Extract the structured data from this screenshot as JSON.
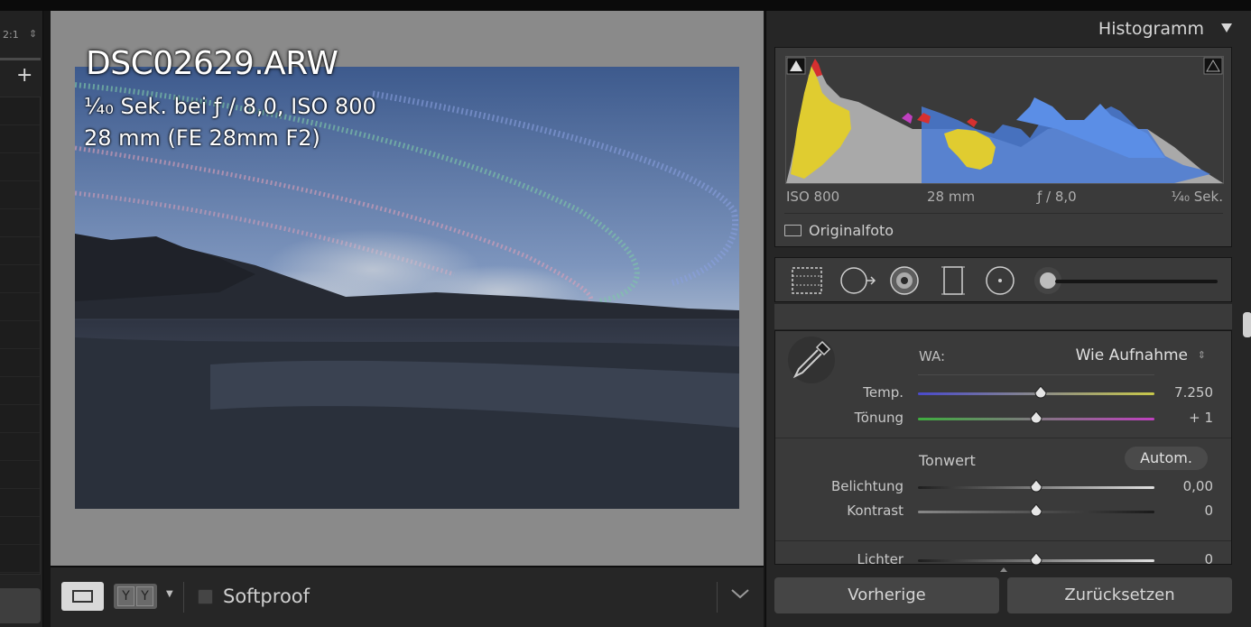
{
  "left_panel": {
    "zoom_ratio": "2:1",
    "zoom_stepper_icon": "updown-stepper-icon",
    "add_icon": "+"
  },
  "loupe": {
    "filename": "DSC02629.ARW",
    "exposure_info": "¹⁄₄₀ Sek. bei ƒ / 8,0, ISO 800",
    "lens_info": "28 mm (FE 28mm F2)"
  },
  "toolbar": {
    "compare_left": "Y",
    "compare_right": "Y",
    "softproof_label": "Softproof",
    "softproof_checked": false
  },
  "histogram": {
    "title": "Histogramm",
    "iso": "ISO 800",
    "focal_length": "28 mm",
    "aperture": "ƒ / 8,0",
    "shutter": "¹⁄₄₀ Sek.",
    "original_label": "Originalfoto",
    "original_checked": false
  },
  "basic": {
    "wb_label": "WA:",
    "wb_value": "Wie Aufnahme",
    "tone_label": "Tonwert",
    "auto_label": "Autom.",
    "sliders": [
      {
        "label": "Temp.",
        "value": "7.250",
        "position": 0.52
      },
      {
        "label": "Tönung",
        "value": "+ 1",
        "position": 0.5
      },
      {
        "label": "Belichtung",
        "value": "0,00",
        "position": 0.5
      },
      {
        "label": "Kontrast",
        "value": "0",
        "position": 0.5
      },
      {
        "label": "Lichter",
        "value": "0",
        "position": 0.5
      }
    ]
  },
  "buttons": {
    "previous": "Vorherige",
    "reset": "Zurücksetzen"
  },
  "colors": {
    "panel_bg": "#3a3a3a",
    "loupe_bg": "#8a8a8a",
    "temp_start": "#4a4acc",
    "temp_end": "#c8c84a",
    "tint_start": "#3fae3f",
    "tint_end": "#c040c0"
  }
}
